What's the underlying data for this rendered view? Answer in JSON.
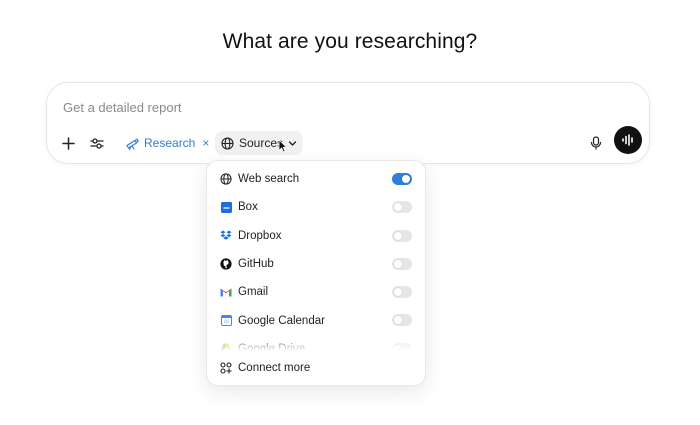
{
  "heading": "What are you researching?",
  "composer": {
    "placeholder": "Get a detailed report",
    "value": ""
  },
  "toolbar": {
    "research_label": "Research",
    "research_remove": "×",
    "sources_label": "Sources"
  },
  "sources_menu": {
    "items": [
      {
        "label": "Web search",
        "icon": "globe-icon",
        "enabled": true
      },
      {
        "label": "Box",
        "icon": "box-icon",
        "enabled": false
      },
      {
        "label": "Dropbox",
        "icon": "dropbox-icon",
        "enabled": false
      },
      {
        "label": "GitHub",
        "icon": "github-icon",
        "enabled": false
      },
      {
        "label": "Gmail",
        "icon": "gmail-icon",
        "enabled": false
      },
      {
        "label": "Google Calendar",
        "icon": "google-calendar-icon",
        "enabled": false
      },
      {
        "label": "Google Drive",
        "icon": "google-drive-icon",
        "enabled": false
      }
    ],
    "connect_more": "Connect more"
  },
  "colors": {
    "accent": "#2f7fd9",
    "voice_button": "#111111"
  }
}
